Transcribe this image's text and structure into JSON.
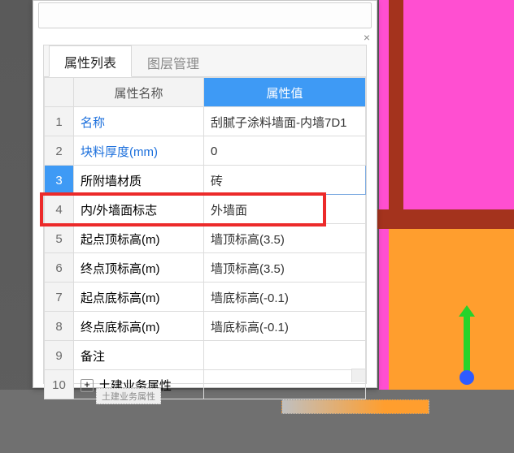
{
  "tabs": {
    "properties": "属性列表",
    "layers": "图层管理"
  },
  "headers": {
    "name": "属性名称",
    "value": "属性值"
  },
  "rows": [
    {
      "num": "1",
      "name": "名称",
      "name_link": true,
      "value": "刮腻子涂料墙面-内墙7D1"
    },
    {
      "num": "2",
      "name": "块料厚度(mm)",
      "name_link": true,
      "value": "0"
    },
    {
      "num": "3",
      "name": "所附墙材质",
      "name_link": false,
      "value": "砖",
      "selected": true
    },
    {
      "num": "4",
      "name": "内/外墙面标志",
      "name_link": false,
      "value": "外墙面",
      "highlight": true
    },
    {
      "num": "5",
      "name": "起点顶标高(m)",
      "name_link": false,
      "value": "墙顶标高(3.5)"
    },
    {
      "num": "6",
      "name": "终点顶标高(m)",
      "name_link": false,
      "value": "墙顶标高(3.5)"
    },
    {
      "num": "7",
      "name": "起点底标高(m)",
      "name_link": false,
      "value": "墙底标高(-0.1)"
    },
    {
      "num": "8",
      "name": "终点底标高(m)",
      "name_link": false,
      "value": "墙底标高(-0.1)"
    },
    {
      "num": "9",
      "name": "备注",
      "name_link": false,
      "value": ""
    },
    {
      "num": "10",
      "name": "土建业务属性",
      "name_link": false,
      "value": "",
      "expandable": true
    }
  ],
  "icons": {
    "close": "×",
    "plus": "+"
  },
  "ghost_label": "土建业务属性"
}
